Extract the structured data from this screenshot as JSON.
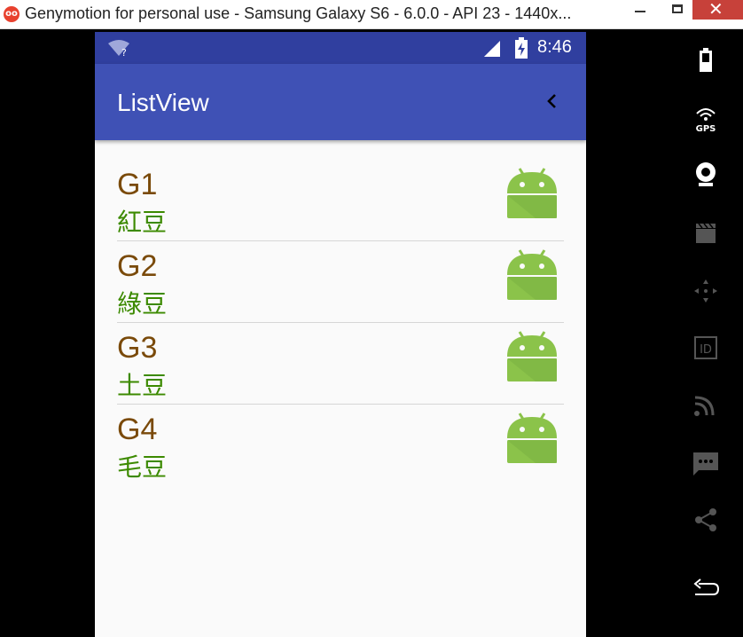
{
  "window": {
    "title": "Genymotion for personal use - Samsung Galaxy S6 - 6.0.0 - API 23 - 1440x...",
    "app_icon_text": "oo",
    "close_glyph": "✕"
  },
  "statusbar": {
    "time": "8:46",
    "wifi_badge": "?"
  },
  "appbar": {
    "title": "ListView",
    "back_icon": "chevron-left-icon"
  },
  "list": {
    "items": [
      {
        "title": "G1",
        "subtitle": "紅豆",
        "icon": "android-icon"
      },
      {
        "title": "G2",
        "subtitle": "綠豆",
        "icon": "android-icon"
      },
      {
        "title": "G3",
        "subtitle": "土豆",
        "icon": "android-icon"
      },
      {
        "title": "G4",
        "subtitle": "毛豆",
        "icon": "android-icon"
      }
    ]
  },
  "sidebar": {
    "tools": [
      "battery-icon",
      "gps-icon",
      "webcam-icon",
      "capture-icon",
      "dpad-icon",
      "id-icon",
      "cast-icon",
      "sms-icon",
      "share-icon",
      "back-icon"
    ],
    "gps_label": "GPS",
    "id_label": "ID"
  },
  "colors": {
    "statusbar": "#303f9f",
    "appbar": "#3f51b5",
    "item_title": "#7a4a0a",
    "item_subtitle": "#3c8a00",
    "android_green": "#8bc34a"
  }
}
